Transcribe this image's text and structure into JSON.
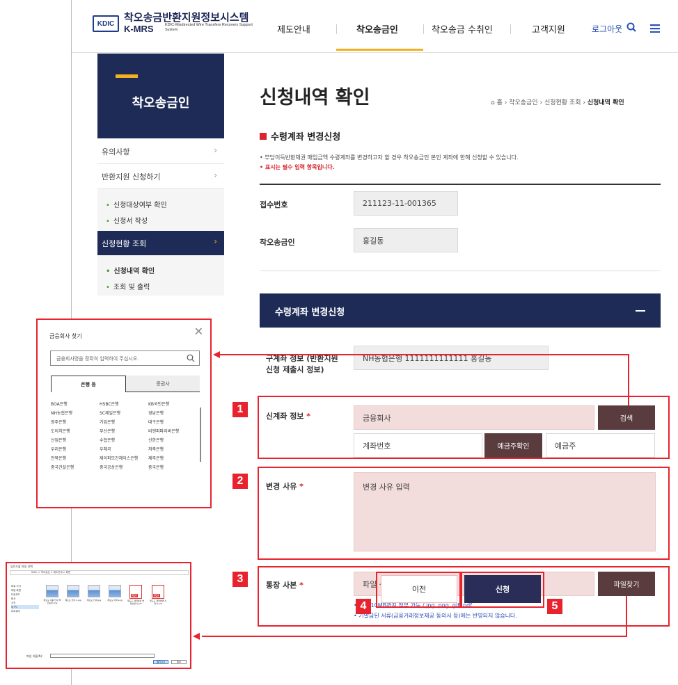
{
  "header": {
    "logo_mark": "KDIC",
    "logo_title": "착오송금반환지원정보시스템",
    "logo_sub": "K-MRS",
    "logo_tagline": "KDIC-Misdirected Wire Transfers Recovery Support System",
    "nav": [
      "제도안내",
      "착오송금인",
      "착오송금 수취인",
      "고객지원"
    ],
    "logout": "로그아웃",
    "accent": "#f1b121",
    "navy": "#1e2b57"
  },
  "sidebar": {
    "title": "착오송금인",
    "items": [
      "유의사항",
      "반환지원 신청하기"
    ],
    "apply_sub": [
      "신청대상여부 확인",
      "신청서 작성"
    ],
    "active": "신청현황 조회",
    "active_sub": [
      "신청내역 확인",
      "조회 및 출력"
    ]
  },
  "main": {
    "title": "신청내역 확인",
    "breadcrumb": {
      "home": "홈",
      "path1": "착오송금인",
      "path2": "신청현황 조회",
      "current": "신청내역 확인"
    },
    "section_title": "수령계좌 변경신청",
    "note": "• 부당이득반환채권 매입금액 수령계좌를 변경하고자 할 경우 착오송금인 본인 계좌에 한해 신청할 수 있습니다.",
    "note_required": "• 표시는 필수 입력 항목입니다.",
    "receipt_label": "접수번호",
    "receipt_value": "211123-11-001365",
    "sender_label": "착오송금인",
    "sender_value": "홍길동",
    "panel_title": "수령계좌 변경신청",
    "old_account_label": "구계좌 정보 (반환지원 신청 제출시 정보)",
    "old_account_value": "NH농협은행 1111111111111 홍길동",
    "new_account_label": "신계좌 정보",
    "bank_placeholder": "금융회사",
    "search_button": "검색",
    "account_placeholder": "계좌번호",
    "verify_button": "예금주확인",
    "holder_placeholder": "예금주",
    "reason_label": "변경 사유",
    "reason_placeholder": "변경 사유 입력",
    "passbook_label": "통장 사본",
    "file_placeholder": "파일 선택",
    "file_button": "파일찾기",
    "file_hint1": "• 최대 10MB까지 첨부 가능 / jpg, png, gif, pdf",
    "file_hint2": "• 기발급된 서류(금융거래정보제공 동의서 등)에는 반영되지 않습니다.",
    "prev_button": "이전",
    "submit_button": "신청",
    "required_mark": "*"
  },
  "badges": [
    "1",
    "2",
    "3",
    "4",
    "5"
  ],
  "popup": {
    "title": "금융회사 찾기",
    "search_placeholder": "금융회사명을 정확히 입력하여 주십시오.",
    "tab_bank": "은행 등",
    "tab_securities": "증권사",
    "banks": [
      [
        "BOA은행",
        "HSBC은행",
        "KB국민은행"
      ],
      [
        "NH농협은행",
        "SC제일은행",
        "경남은행"
      ],
      [
        "광주은행",
        "기업은행",
        "대구은행"
      ],
      [
        "도이치은행",
        "부산은행",
        "비엔피파리바은행"
      ],
      [
        "산업은행",
        "수협은행",
        "신한은행"
      ],
      [
        "우리은행",
        "우체국",
        "저축은행"
      ],
      [
        "전북은행",
        "제이피모간체이스은행",
        "제주은행"
      ],
      [
        "중국건설은행",
        "중국공상은행",
        "중국은행"
      ]
    ]
  },
  "file_dialog": {
    "title": "업로드할 파일 선택",
    "address": "KDIC > 착오송금 > 제도안내 > 화면",
    "sidebar": [
      "바로 가기",
      "바탕 화면",
      "다운로드",
      "문서",
      "사진",
      "내 PC",
      "네트워크"
    ],
    "files": [
      {
        "name": "제도도 이용 안내 착오송금.png",
        "type": "img"
      },
      {
        "name": "제도도 안내 2.jpg",
        "type": "img"
      },
      {
        "name": "제도도 안내.jpg",
        "type": "img"
      },
      {
        "name": "제도도 이력.png",
        "type": "img"
      },
      {
        "name": "제도도 계좌정보 변경신청서.pdf",
        "type": "pdf"
      },
      {
        "name": "제도도 계좌변경 신청서.pdf",
        "type": "pdf"
      }
    ],
    "filename_label": "파일 이름(N):",
    "open_button": "열기(O)",
    "cancel_button": "취소"
  }
}
